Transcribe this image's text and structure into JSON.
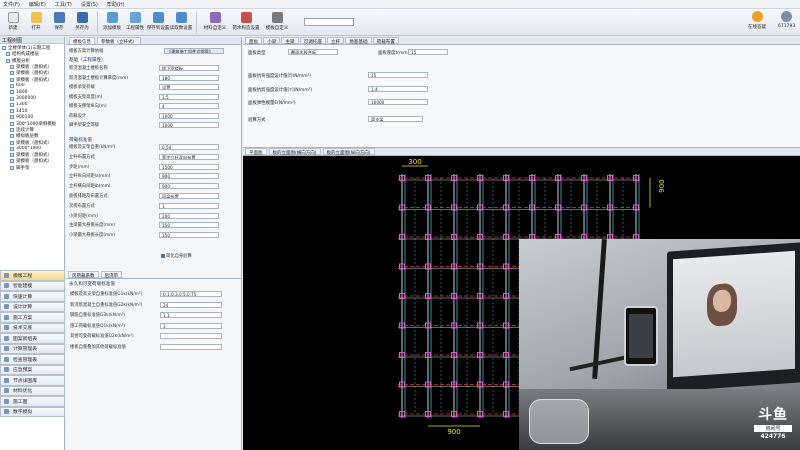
{
  "menu": [
    "文件(F)",
    "编辑(E)",
    "工具(T)",
    "设置(S)",
    "帮助(H)"
  ],
  "toolbar": {
    "buttons": [
      "新建",
      "打开",
      "保存",
      "另存为",
      "添加模板",
      "工程属性",
      "保存到设置",
      "读取数设置",
      "材料自定义",
      "荷水构造设置",
      "模板自定义"
    ],
    "right_buttons": [
      "在线答疑",
      "671793"
    ]
  },
  "left": {
    "title": "工程树图",
    "tree": [
      "全楼单体(1)三期工程",
      "结构构成楼层",
      "模版分析",
      "梁模板（盘扣式）",
      "梁模板（盘扣式）",
      "梁模板（盘扣式）",
      "600",
      "1800",
      "3000000",
      "1300",
      "1450",
      "900100",
      "300*1000梁侧模板",
      "连续计算",
      "模拟板层数",
      "梁模板（盘扣式）",
      "3000*1800",
      "梁模板（盘扣式）",
      "梁模板（盘扣式）",
      "脚手架"
    ],
    "modules": [
      "模版工程",
      "智能建模",
      "快速计算",
      "设计计算",
      "施工方案",
      "技术交底",
      "图案新组表",
      "计算管理表",
      "检查管理表",
      "应急预案",
      "节点详图库",
      "材料优化",
      "施工图",
      "数字模拟"
    ]
  },
  "mid": {
    "tabs": [
      "模板信息",
      "参数板（立杆式）"
    ],
    "header_label": "模板方案计算依据",
    "header_value": "《建筑施工扣件式钢管》",
    "sec1": "基础（工程属性）",
    "fields": [
      {
        "label": "新浇混凝土楼板名称",
        "value": "地下室楼板"
      },
      {
        "label": "新浇混凝土楼板计算厚度(mm)",
        "value": "180"
      },
      {
        "label": "模板承受荷载",
        "value": "设置"
      },
      {
        "label": "模板支架高度(m)",
        "value": "1.5"
      },
      {
        "label": "模板支撑架纵向(m)",
        "value": "4"
      },
      {
        "label": "荷载设计",
        "value": "1000"
      },
      {
        "label": "脚手架安全等级",
        "value": "1000"
      }
    ],
    "sec2": "荷载标准值",
    "fields2": [
      {
        "label": "模板及支架自重(kN/m²)",
        "value": "0.54"
      },
      {
        "label": "立杆布置方式",
        "value": "等步立杆双向布置"
      },
      {
        "label": "步距(mm)",
        "value": "1500"
      },
      {
        "label": "立杆纵向间距la(mm)",
        "value": "900"
      },
      {
        "label": "立杆横向间距lb(mm)",
        "value": "900"
      },
      {
        "label": "面板排距及布置方式",
        "value": "同梁布置"
      },
      {
        "label": "次楞布置方式",
        "value": "1"
      },
      {
        "label": "小梁间距(mm)",
        "value": "200"
      },
      {
        "label": "主梁最大悬挑长度(mm)",
        "value": "150"
      },
      {
        "label": "小梁最大悬挑长度(mm)",
        "value": "150"
      }
    ],
    "checkbox_label": "简化自身验算",
    "lower_tabs": [
      "风荷载系数",
      "后浇带"
    ],
    "lower_sec": "永久和可变荷载标准值",
    "lower_fields": [
      {
        "label": "模板及其支架自重标准值G1k(kN/m²)",
        "value": "0.1,0.3,0.5,0.75"
      },
      {
        "label": "新浇筑混凝土自重标准值G2k(kN/m³)",
        "value": "24"
      },
      {
        "label": "钢筋自重标准值G3k(kN/m³)",
        "value": "1.1"
      },
      {
        "label": "施工荷载标准值Q1k(kN/m²)",
        "value": "3"
      },
      {
        "label": "其他可变荷载标准值Q2k(kN/m²)",
        "value": ""
      },
      {
        "label": "楼板自重叠加其他荷载标准值",
        "value": ""
      }
    ]
  },
  "props": {
    "tabs": [
      "面板",
      "小梁",
      "主梁",
      "可调托座",
      "立杆",
      "地基基础",
      "荷载布置"
    ],
    "fields": [
      {
        "label": "面板类型",
        "value": "覆面木胶合板"
      },
      {
        "label": "面板厚度t(mm)",
        "value": "15"
      },
      {
        "label": "面板抗弯强度设计值[f](N/mm²)",
        "value": "15"
      },
      {
        "label": "面板抗剪强度设计值[τ](N/mm²)",
        "value": "1.4"
      },
      {
        "label": "面板弹性模量E(N/mm²)",
        "value": "10000"
      },
      {
        "label": "验算方式",
        "value": "简支梁"
      }
    ]
  },
  "cad": {
    "tabs": [
      "平面图",
      "板的立面图(横向方向)",
      "板的立面图(纵向方向)"
    ],
    "dim_top": "300",
    "dim_right": "900",
    "dim_bottom": "900"
  },
  "overlay": {
    "brand": "斗鱼",
    "room_label": "房间号",
    "room": "424776"
  },
  "colors": {
    "accent": "#2b5c9a",
    "cad_bg": "#000000",
    "dim": "#e6e600",
    "rebar": "#2fbfbf",
    "node": "#d85bd8"
  }
}
